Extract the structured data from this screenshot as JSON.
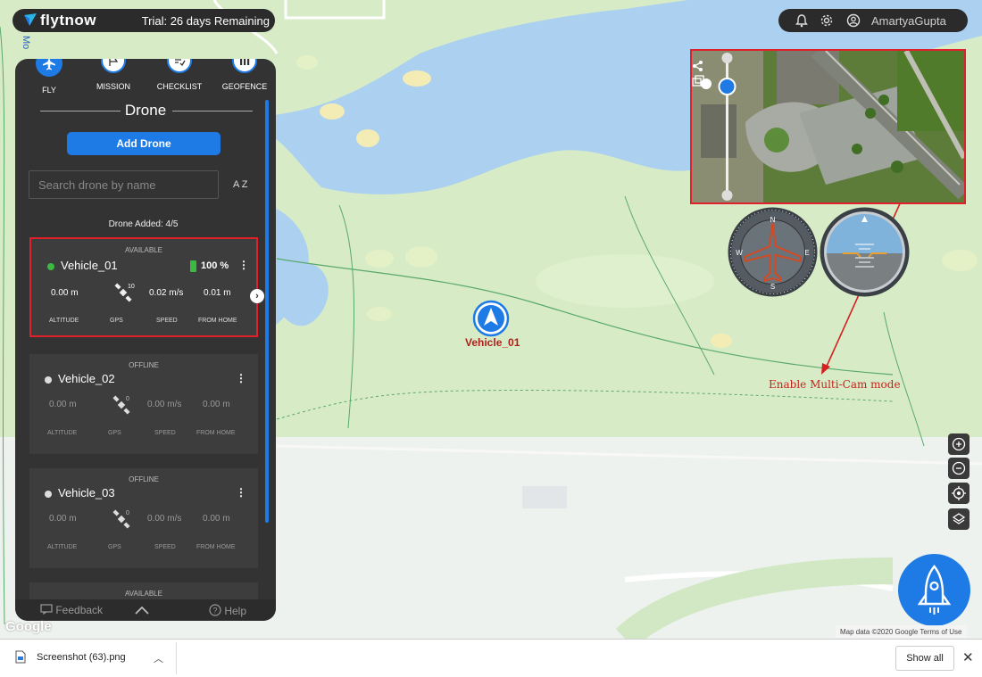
{
  "app": {
    "logo": "flytnow",
    "trial": "Trial: 26 days Remaining",
    "user_name": "AmartyaGupta",
    "side_tab": "Mo"
  },
  "nav": [
    {
      "label": "FLY",
      "icon": "airplane-icon"
    },
    {
      "label": "MISSION",
      "icon": "flag-icon"
    },
    {
      "label": "CHECKLIST",
      "icon": "checklist-icon"
    },
    {
      "label": "GEOFENCE",
      "icon": "geofence-icon"
    }
  ],
  "drone_panel": {
    "title": "Drone",
    "add_button": "Add Drone",
    "search_placeholder": "Search drone by name",
    "sort_label": "A Z",
    "drone_count": "Drone Added: 4/5"
  },
  "vehicles": [
    {
      "status": "AVAILABLE",
      "name": "Vehicle_01",
      "battery": "100 %",
      "altitude": "0.00 m",
      "gps": "10",
      "speed": "0.02 m/s",
      "from_home": "0.01 m",
      "online": true
    },
    {
      "status": "OFFLINE",
      "name": "Vehicle_02",
      "battery": "",
      "altitude": "0.00 m",
      "gps": "0",
      "speed": "0.00 m/s",
      "from_home": "0.00 m",
      "online": false
    },
    {
      "status": "OFFLINE",
      "name": "Vehicle_03",
      "battery": "",
      "altitude": "0.00 m",
      "gps": "0",
      "speed": "0.00 m/s",
      "from_home": "0.00 m",
      "online": false
    },
    {
      "status": "AVAILABLE"
    }
  ],
  "labels": {
    "altitude": "ALTITUDE",
    "gps": "GPS",
    "speed": "SPEED",
    "from_home": "FROM HOME"
  },
  "footer": {
    "feedback": "Feedback",
    "help": "Help"
  },
  "map": {
    "vehicle_marker_label": "Vehicle_01",
    "annotation": "Enable Multi-Cam mode",
    "google": "Google",
    "attribution": "Map data ©2020 Google   Terms of Use"
  },
  "download_bar": {
    "file_name": "Screenshot (63).png",
    "show_all": "Show all",
    "close": "✕"
  },
  "colors": {
    "accent": "#1e7be6",
    "panel": "#333333",
    "highlight": "#e0202a",
    "online": "#3cb940"
  }
}
